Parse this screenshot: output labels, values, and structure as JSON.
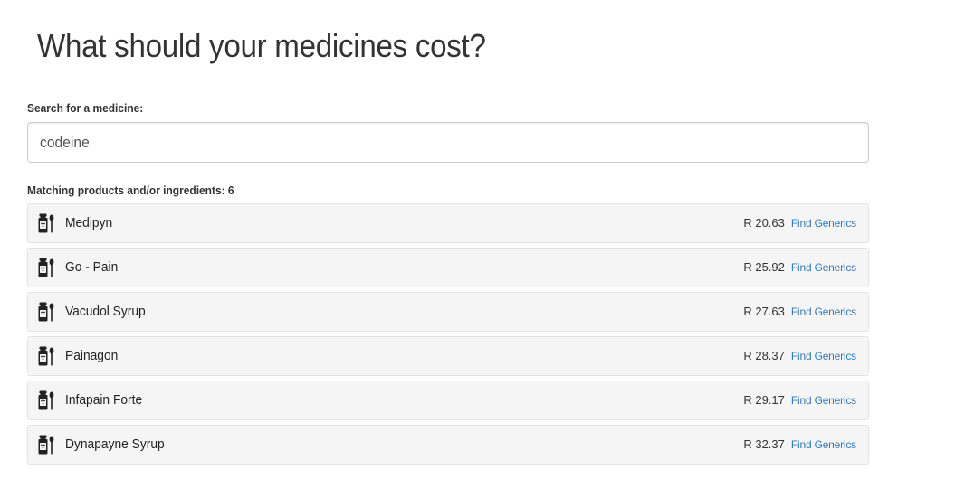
{
  "page": {
    "title": "What should your medicines cost?"
  },
  "search": {
    "label": "Search for a medicine:",
    "value": "codeine",
    "placeholder": ""
  },
  "results": {
    "label": "Matching products and/or ingredients: 6",
    "icon": "medicine-bottle-spoon-icon",
    "link_color": "#337ab7",
    "items": [
      {
        "name": "Medipyn",
        "price": "R 20.63",
        "link": "Find Generics"
      },
      {
        "name": "Go - Pain",
        "price": "R 25.92",
        "link": "Find Generics"
      },
      {
        "name": "Vacudol Syrup",
        "price": "R 27.63",
        "link": "Find Generics"
      },
      {
        "name": "Painagon",
        "price": "R 28.37",
        "link": "Find Generics"
      },
      {
        "name": "Infapain Forte",
        "price": "R 29.17",
        "link": "Find Generics"
      },
      {
        "name": "Dynapayne Syrup",
        "price": "R 32.37",
        "link": "Find Generics"
      }
    ]
  }
}
